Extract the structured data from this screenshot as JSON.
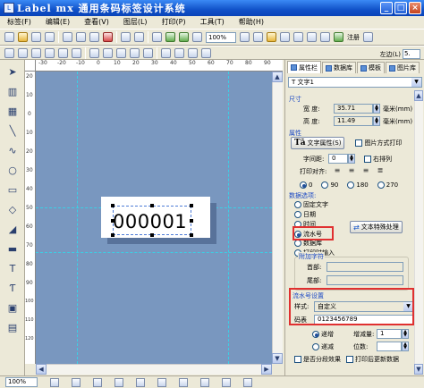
{
  "window": {
    "title": "Label mx 通用条码标签设计系统",
    "minimize": "_",
    "maximize": "□",
    "close": "×"
  },
  "menu": [
    "标签(F)",
    "编辑(E)",
    "查看(V)",
    "图层(L)",
    "打印(P)",
    "工具(T)",
    "帮助(H)"
  ],
  "toolbar": {
    "zoom": "100%",
    "register": "注册",
    "left_label": "左边(L)",
    "left_value": "5."
  },
  "ruler": {
    "h": [
      "-30",
      "-20",
      "-10",
      "0",
      "10",
      "20",
      "30",
      "40",
      "50",
      "60",
      "70",
      "80",
      "90"
    ],
    "v": [
      "20",
      "10",
      "0",
      "10",
      "20",
      "30",
      "40",
      "50",
      "60",
      "70",
      "80",
      "90",
      "100",
      "110",
      "120"
    ]
  },
  "canvas": {
    "serial_text": "000001"
  },
  "status": {
    "zoom": "100%"
  },
  "panel": {
    "tabs": [
      "属性栏",
      "数据库",
      "模板",
      "图片库"
    ],
    "object": "T 文字1",
    "size_title": "尺寸",
    "width_label": "宽    度:",
    "width_value": "35.71",
    "height_label": "高    度:",
    "height_value": "11.49",
    "unit": "毫米(mm)",
    "attr_title": "属性",
    "text_attr_btn": "文字属性(S)",
    "fit_print": "图片方式打印",
    "char_spacing_label": "字间距:",
    "char_spacing_value": "0",
    "right_arrange": "右排列",
    "print_align_label": "打印对齐:",
    "rotation_values": [
      "0",
      "90",
      "180",
      "270"
    ],
    "data_title": "数据选项:",
    "data_options": [
      "固定文字",
      "日期",
      "时间",
      "流水号",
      "数据库",
      "打印时输入"
    ],
    "text_special_btn": "文本特殊处理",
    "append_title": "附加字符",
    "prefix_label": "首部:",
    "suffix_label": "尾部:",
    "serial_title": "流水号设置",
    "style_label": "样式:",
    "style_value": "自定义",
    "code_label": "码表",
    "code_value": "0123456789",
    "inc": "递增",
    "dec": "递减",
    "step_label": "增减量:",
    "step_value": "1",
    "digits_label": "位数:",
    "segmented": "是否分段效果",
    "refresh_after_print": "打印后更新数据"
  }
}
